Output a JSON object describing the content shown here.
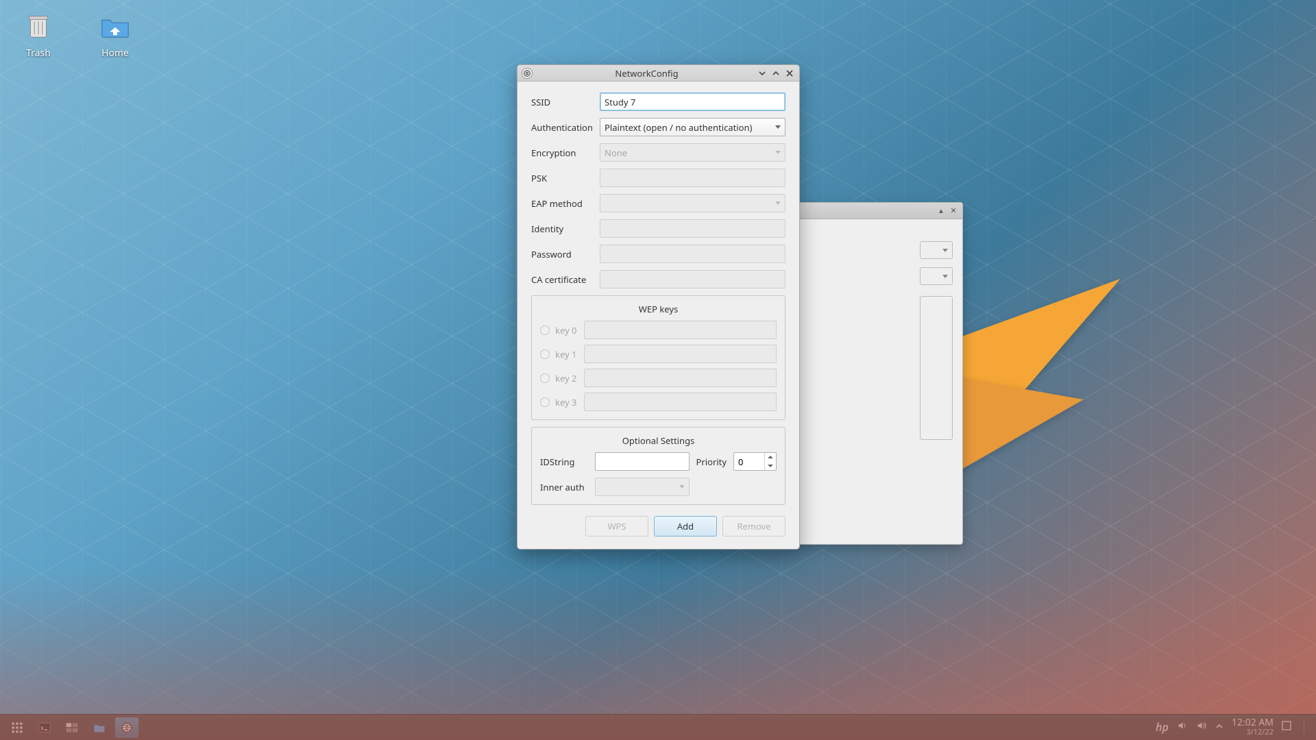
{
  "desktop": {
    "icons": {
      "trash": "Trash",
      "home": "Home"
    }
  },
  "dialog": {
    "title": "NetworkConfig",
    "fields": {
      "ssid": {
        "label": "SSID",
        "value": "Study 7"
      },
      "auth": {
        "label": "Authentication",
        "value": "Plaintext (open / no authentication)"
      },
      "encryption": {
        "label": "Encryption",
        "value": "None"
      },
      "psk": {
        "label": "PSK",
        "value": ""
      },
      "eap": {
        "label": "EAP method",
        "value": ""
      },
      "identity": {
        "label": "Identity",
        "value": ""
      },
      "password": {
        "label": "Password",
        "value": ""
      },
      "ca": {
        "label": "CA certificate",
        "value": ""
      }
    },
    "wep": {
      "title": "WEP keys",
      "keys": [
        "key 0",
        "key 1",
        "key 2",
        "key 3"
      ]
    },
    "optional": {
      "title": "Optional Settings",
      "idstring_label": "IDString",
      "idstring_value": "",
      "priority_label": "Priority",
      "priority_value": "0",
      "inner_auth_label": "Inner auth"
    },
    "buttons": {
      "wps": "WPS",
      "add": "Add",
      "remove": "Remove"
    }
  },
  "taskbar": {
    "clock": {
      "time": "12:02 AM",
      "date": "3/12/22"
    },
    "brand": "hp"
  }
}
